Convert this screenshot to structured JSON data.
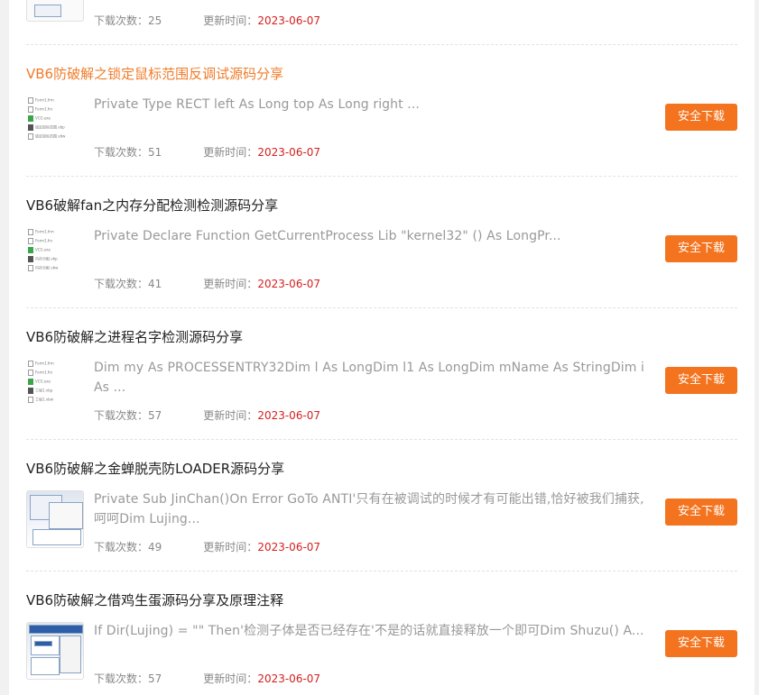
{
  "colors": {
    "accent": "#f3731e",
    "title_active": "#f07c2a",
    "date": "#d42020"
  },
  "top_fragment": {
    "downloads_label": "下载次数：",
    "downloads": "25",
    "updated_label": "更新时间：",
    "date": "2023-06-07"
  },
  "items": [
    {
      "title": "VB6防破解之锁定鼠标范围反调试源码分享",
      "desc": "Private Type RECT left As Long top As Long right ...",
      "downloads_label": "下载次数：",
      "downloads": "51",
      "updated_label": "更新时间：",
      "date": "2023-06-07",
      "button": "安全下载"
    },
    {
      "title": "VB6破解fan之内存分配检测检测源码分享",
      "desc": "Private Declare Function GetCurrentProcess Lib \"kernel32\" () As LongPr...",
      "downloads_label": "下载次数：",
      "downloads": "41",
      "updated_label": "更新时间：",
      "date": "2023-06-07",
      "button": "安全下载"
    },
    {
      "title": "VB6防破解之进程名字检测源码分享",
      "desc": "Dim my As PROCESSENTRY32Dim l As LongDim l1 As LongDim mName As StringDim i As ...",
      "downloads_label": "下载次数：",
      "downloads": "57",
      "updated_label": "更新时间：",
      "date": "2023-06-07",
      "button": "安全下载"
    },
    {
      "title": "VB6防破解之金蝉脱壳防LOADER源码分享",
      "desc": "Private Sub JinChan()On Error GoTo ANTI'只有在被调试的时候才有可能出错,恰好被我们捕获,呵呵Dim Lujing...",
      "downloads_label": "下载次数：",
      "downloads": "49",
      "updated_label": "更新时间：",
      "date": "2023-06-07",
      "button": "安全下载"
    },
    {
      "title": "VB6防破解之借鸡生蛋源码分享及原理注释",
      "desc": "If Dir(Lujing) = \"\" Then'检测子体是否已经存在'不是的话就直接释放一个即可Dim Shuzu() A...",
      "downloads_label": "下载次数：",
      "downloads": "57",
      "updated_label": "更新时间：",
      "date": "2023-06-07",
      "button": "安全下载"
    }
  ]
}
